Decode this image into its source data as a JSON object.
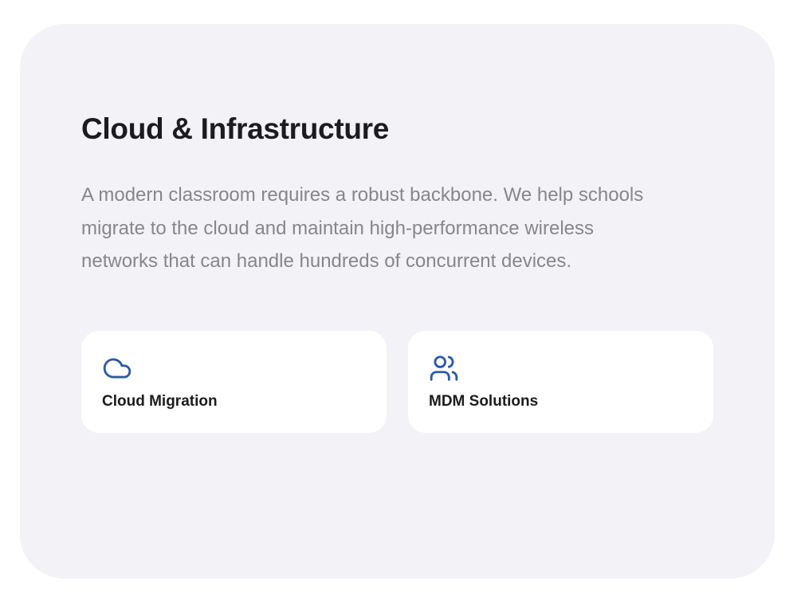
{
  "section": {
    "title": "Cloud & Infrastructure",
    "description": "A modern classroom requires a robust backbone. We help schools migrate to the cloud and maintain high-performance wireless networks that can handle hundreds of concurrent devices."
  },
  "features": [
    {
      "label": "Cloud Migration",
      "icon": "cloud-icon"
    },
    {
      "label": "MDM Solutions",
      "icon": "users-icon"
    }
  ],
  "colors": {
    "card_background": "#f2f2f7",
    "tile_background": "#ffffff",
    "title_text": "#1c1c1e",
    "description_text": "#86868b",
    "icon_accent": "#2d5aa6"
  }
}
